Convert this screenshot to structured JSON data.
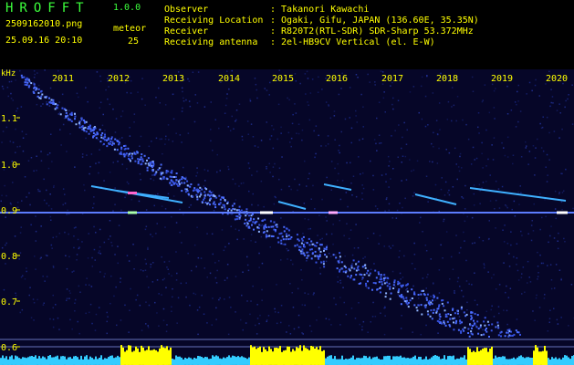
{
  "header": {
    "app_title": "HROFFT",
    "version": "1.0.0",
    "file_name": "2509162010.png",
    "timestamp": "25.09.16 20:10",
    "meteor_label": "meteor",
    "meteor_count": "25",
    "info": [
      {
        "key": "Observer",
        "value": ": Takanori Kawachi"
      },
      {
        "key": "Receiving Location",
        "value": ": Ogaki, Gifu, JAPAN (136.60E, 35.35N)"
      },
      {
        "key": "Receiver",
        "value": ": R820T2(RTL-SDR) SDR-Sharp 53.372MHz"
      },
      {
        "key": "Receiving antenna",
        "value": ": 2el-HB9CV Vertical (el. E-W)"
      }
    ]
  },
  "plot": {
    "y_unit": "kHz",
    "y_ticks": [
      "1.1",
      "1.0",
      "0.9",
      "0.8",
      "0.7",
      "0.6"
    ],
    "x_ticks": [
      "2011",
      "2012",
      "2013",
      "2014",
      "2015",
      "2016",
      "2017",
      "2018",
      "2019",
      "2020"
    ]
  },
  "colors": {
    "header_green": "#3cff3c",
    "header_yellow": "#ffff00",
    "spectrogram_bg": "#060628",
    "signal_blue": "#4a6cff",
    "bar_cyan": "#33ccff",
    "bar_yellow": "#ffff00"
  }
}
